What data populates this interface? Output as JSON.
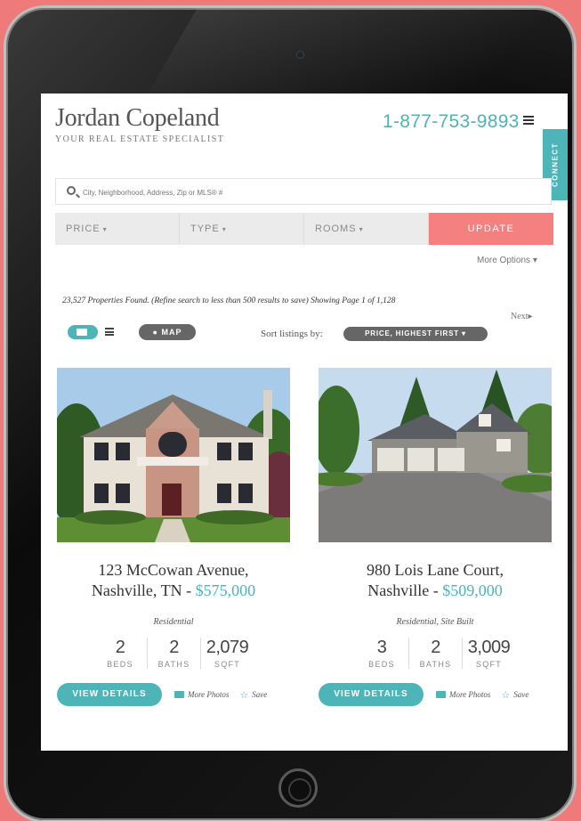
{
  "brand": {
    "name": "Jordan Copeland",
    "tagline": "YOUR REAL ESTATE SPECIALIST",
    "phone": "1-877-753-9893",
    "connect_label": "CONNECT"
  },
  "search": {
    "placeholder": "City, Neighborhood, Address, Zip or MLS® #"
  },
  "filters": {
    "price": "PRICE",
    "type": "TYPE",
    "rooms": "ROOMS",
    "update": "UPDATE",
    "more_options": "More Options"
  },
  "results": {
    "summary": "23,527 Properties Found. (Refine search to less than 500 results to save) Showing Page 1 of 1,128",
    "next": "Next"
  },
  "toolbar": {
    "map_label": "MAP",
    "sort_label": "Sort listings by:",
    "sort_value": "PRICE, HIGHEST FIRST"
  },
  "listings": [
    {
      "address_line1": "123 McCowan Avenue,",
      "address_line2": "Nashville, TN - ",
      "price": "$575,000",
      "type": "Residential",
      "beds": "2",
      "beds_label": "BEDS",
      "baths": "2",
      "baths_label": "BATHS",
      "sqft": "2,079",
      "sqft_label": "SQFT",
      "details_label": "VIEW DETAILS",
      "photos_label": "More Photos",
      "save_label": "Save"
    },
    {
      "address_line1": "980 Lois Lane Court,",
      "address_line2": "Nashville - ",
      "price": "$509,000",
      "type": "Residential, Site Built",
      "beds": "3",
      "beds_label": "BEDS",
      "baths": "2",
      "baths_label": "BATHS",
      "sqft": "3,009",
      "sqft_label": "SQFT",
      "details_label": "VIEW DETAILS",
      "photos_label": "More Photos",
      "save_label": "Save"
    }
  ],
  "colors": {
    "accent": "#4db4b8",
    "update": "#f58080",
    "background": "#ee7a7a"
  }
}
